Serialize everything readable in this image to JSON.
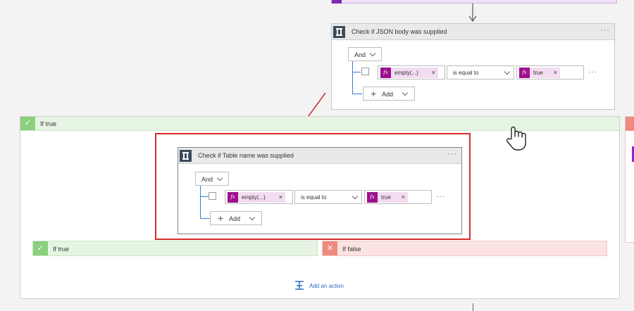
{
  "outer_condition": {
    "title": "Check if JSON body was supplied",
    "more": "···",
    "group_operator": "And",
    "row": {
      "left_token": "empty(...)",
      "operator": "is equal to",
      "right_token": "true",
      "more": "···"
    },
    "add_label": "Add"
  },
  "outer_true_branch": {
    "label": "If true"
  },
  "inner_condition": {
    "title": "Check if Table name was supplied",
    "more": "···",
    "group_operator": "And",
    "row": {
      "left_token": "empty(...)",
      "operator": "is equal to",
      "right_token": "true",
      "more": "···"
    },
    "add_label": "Add"
  },
  "inner_true_branch": {
    "label": "If true"
  },
  "inner_false_branch": {
    "label": "If false"
  },
  "add_action": {
    "label": "Add an action"
  },
  "icons": {
    "fx": "fx",
    "remove_token": "×",
    "plus": "+",
    "check": "✓",
    "cross": "✕"
  },
  "colors": {
    "accent_blue": "#3a7bd5",
    "token_magenta": "#9b0f8e",
    "true_green": "#8ccf7e",
    "false_red": "#f08a80",
    "highlight_red": "#d42d2d"
  }
}
